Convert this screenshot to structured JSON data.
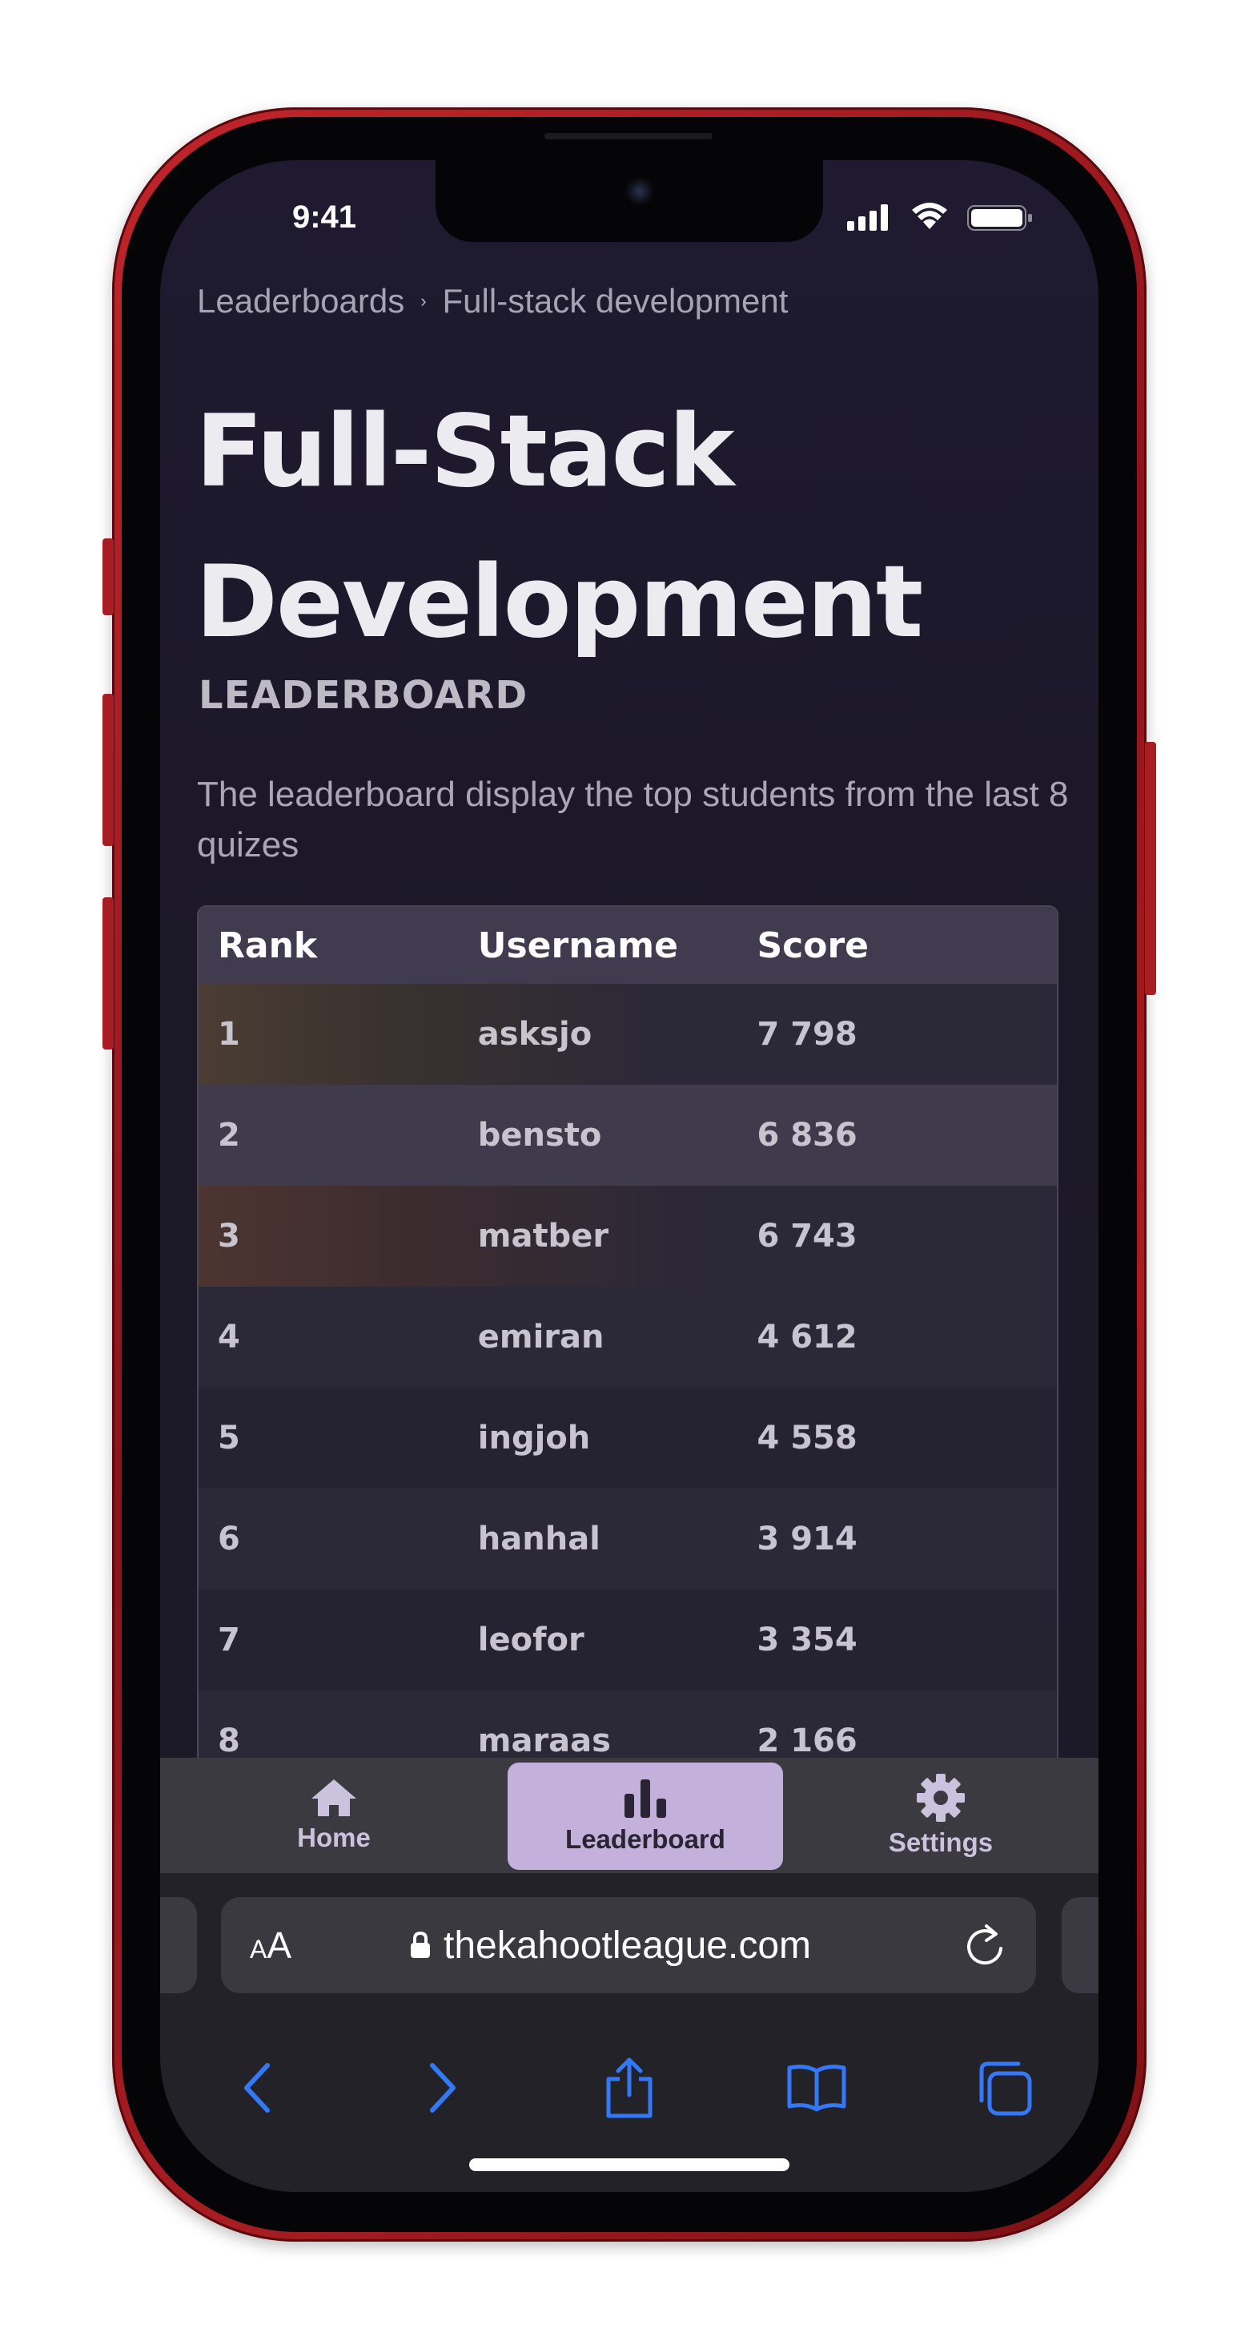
{
  "status_bar": {
    "time": "9:41"
  },
  "breadcrumb": {
    "items": [
      "Leaderboards",
      "Full-stack development"
    ],
    "separator": "›"
  },
  "page": {
    "title_line1": "Full-Stack",
    "title_line2": "Development",
    "subtitle": "LEADERBOARD",
    "description": "The leaderboard display the top students from the last 8 quizes"
  },
  "table": {
    "columns": [
      "Rank",
      "Username",
      "Score"
    ],
    "rows": [
      {
        "rank": "1",
        "username": "asksjo",
        "score": "7 798"
      },
      {
        "rank": "2",
        "username": "bensto",
        "score": "6 836"
      },
      {
        "rank": "3",
        "username": "matber",
        "score": "6 743"
      },
      {
        "rank": "4",
        "username": "emiran",
        "score": "4 612"
      },
      {
        "rank": "5",
        "username": "ingjoh",
        "score": "4 558"
      },
      {
        "rank": "6",
        "username": "hanhal",
        "score": "3 914"
      },
      {
        "rank": "7",
        "username": "leofor",
        "score": "3 354"
      },
      {
        "rank": "8",
        "username": "maraas",
        "score": "2 166"
      }
    ]
  },
  "tab_nav": {
    "items": [
      {
        "label": "Home",
        "icon": "home-icon"
      },
      {
        "label": "Leaderboard",
        "icon": "bar-chart-icon",
        "active": true
      },
      {
        "label": "Settings",
        "icon": "gear-icon"
      }
    ],
    "active_color": "#c3b1dc"
  },
  "safari": {
    "text_size_label_small": "A",
    "text_size_label_large": "A",
    "url": "thekahootleague.com",
    "accent_color": "#3478f6"
  },
  "colors": {
    "phone_frame": "#a81d22",
    "background": "#1f1a30",
    "tab_bar": "#3b3a40"
  }
}
